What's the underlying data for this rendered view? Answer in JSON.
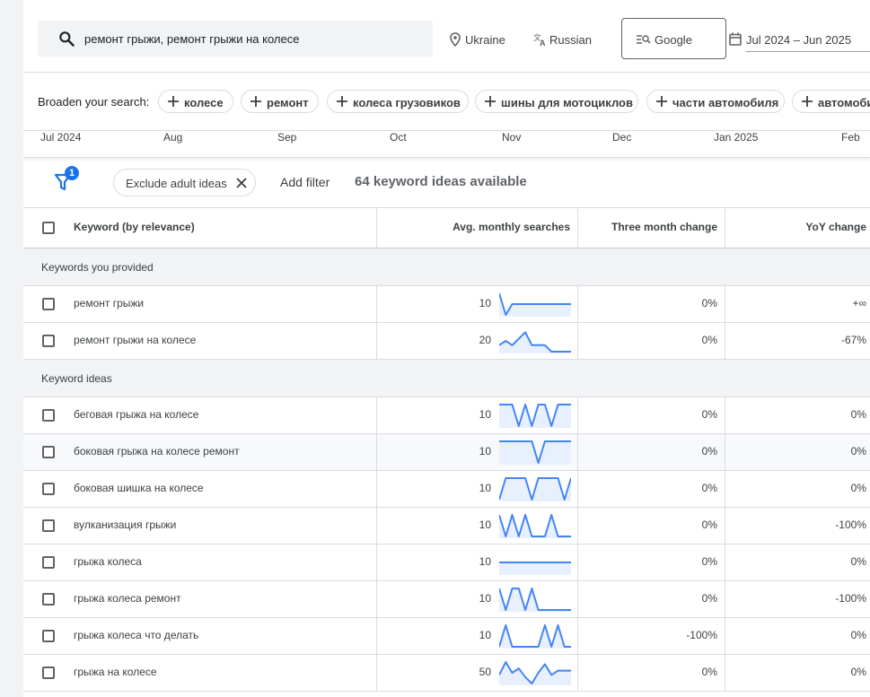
{
  "search": {
    "query": "ремонт грыжи, ремонт грыжи на колесе"
  },
  "location": {
    "label": "Ukraine"
  },
  "language": {
    "label": "Russian"
  },
  "network": {
    "label": "Google"
  },
  "date_range": {
    "label": "Jul 2024 – Jun 2025"
  },
  "broaden": {
    "label": "Broaden your search:",
    "chips": [
      "колесе",
      "ремонт",
      "колеса грузовиков",
      "шины для мотоциклов",
      "части автомобиля",
      "автомобил"
    ]
  },
  "months": [
    "Jul 2024",
    "Aug",
    "Sep",
    "Oct",
    "Nov",
    "Dec",
    "Jan 2025",
    "Feb"
  ],
  "filters": {
    "badge": "1",
    "exclude_chip": "Exclude adult ideas",
    "add_filter": "Add filter",
    "ideas_count": "64 keyword ideas available"
  },
  "table": {
    "headers": {
      "keyword": "Keyword (by relevance)",
      "avg": "Avg. monthly searches",
      "three": "Three month change",
      "yoy": "YoY change"
    },
    "groups": [
      {
        "label": "Keywords you provided",
        "rows": [
          {
            "keyword": "ремонт грыжи",
            "avg": "10",
            "three": "0%",
            "yoy": "+∞",
            "trend": [
              1,
              0,
              0.5,
              0.5,
              0.5,
              0.5,
              0.5,
              0.5,
              0.5,
              0.5,
              0.5,
              0.5
            ]
          },
          {
            "keyword": "ремонт грыжи на колесе",
            "avg": "20",
            "three": "0%",
            "yoy": "-67%",
            "trend": [
              0.3,
              0.5,
              0.3,
              0.6,
              0.9,
              0.3,
              0.3,
              0.3,
              0,
              0,
              0,
              0
            ]
          }
        ]
      },
      {
        "label": "Keyword ideas",
        "rows": [
          {
            "keyword": "беговая грыжа на колесе",
            "avg": "10",
            "three": "0%",
            "yoy": "0%",
            "trend": [
              1,
              1,
              1,
              0,
              1,
              0,
              1,
              1,
              0,
              1,
              1,
              1
            ]
          },
          {
            "keyword": "боковая грыжа на колесе ремонт",
            "avg": "10",
            "three": "0%",
            "yoy": "0%",
            "trend": [
              1,
              1,
              1,
              1,
              1,
              1,
              0,
              1,
              1,
              1,
              1,
              1
            ]
          },
          {
            "keyword": "боковая шишка на колесе",
            "avg": "10",
            "three": "0%",
            "yoy": "0%",
            "trend": [
              0,
              1,
              1,
              1,
              1,
              0,
              1,
              1,
              1,
              1,
              0,
              1
            ]
          },
          {
            "keyword": "вулканизация грыжи",
            "avg": "10",
            "three": "0%",
            "yoy": "-100%",
            "trend": [
              1,
              0,
              1,
              0,
              1,
              0,
              0,
              0,
              1,
              0,
              0,
              0
            ]
          },
          {
            "keyword": "грыжа колеса",
            "avg": "10",
            "three": "0%",
            "yoy": "0%",
            "trend": [
              0.5,
              0.5,
              0.5,
              0.5,
              0.5,
              0.5,
              0.5,
              0.5,
              0.5,
              0.5,
              0.5,
              0.5
            ]
          },
          {
            "keyword": "грыжа колеса ремонт",
            "avg": "10",
            "three": "0%",
            "yoy": "-100%",
            "trend": [
              1,
              0,
              1,
              1,
              0,
              1,
              0,
              0,
              0,
              0,
              0,
              0
            ]
          },
          {
            "keyword": "грыжа колеса что делать",
            "avg": "10",
            "three": "-100%",
            "yoy": "0%",
            "trend": [
              0,
              1,
              0,
              0,
              0,
              0,
              0,
              1,
              0,
              1,
              0,
              0
            ]
          },
          {
            "keyword": "грыжа на колесе",
            "avg": "50",
            "three": "0%",
            "yoy": "0%",
            "trend": [
              0.4,
              1,
              0.5,
              0.7,
              0.3,
              0,
              0.5,
              0.9,
              0.4,
              0.6,
              0.6,
              0.6
            ]
          }
        ]
      }
    ]
  },
  "colors": {
    "accent": "#1a73e8",
    "spark_line": "#4285f4",
    "spark_fill": "#e8f0fe"
  }
}
